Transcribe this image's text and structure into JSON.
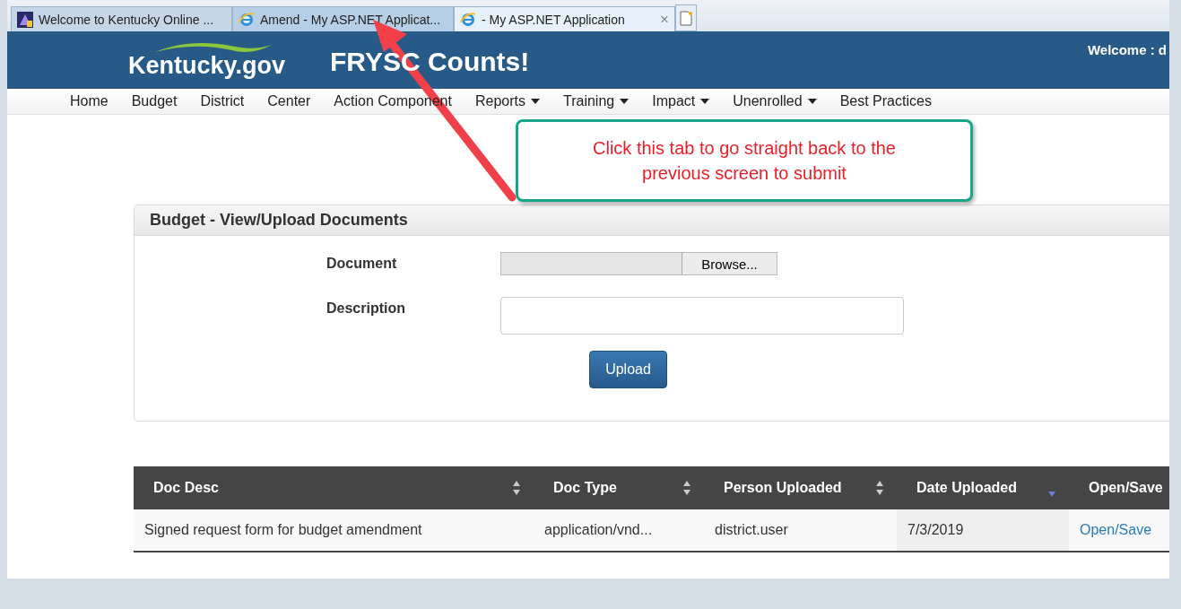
{
  "browser_tabs": [
    {
      "title": "Welcome to Kentucky Online ...",
      "kind": "app",
      "selected": false,
      "hovered": false,
      "closable": false
    },
    {
      "title": "Amend - My ASP.NET Applicat...",
      "kind": "browser",
      "selected": false,
      "hovered": true,
      "closable": false
    },
    {
      "title": "- My ASP.NET Application",
      "kind": "browser",
      "selected": true,
      "hovered": false,
      "closable": true,
      "close": "×"
    }
  ],
  "header": {
    "logo": "Kentucky.gov",
    "title": "FRYSC Counts!",
    "welcome": "Welcome : d"
  },
  "nav": [
    {
      "label": "Home",
      "dropdown": false
    },
    {
      "label": "Budget",
      "dropdown": false
    },
    {
      "label": "District",
      "dropdown": false
    },
    {
      "label": "Center",
      "dropdown": false
    },
    {
      "label": "Action Component",
      "dropdown": false
    },
    {
      "label": "Reports",
      "dropdown": true
    },
    {
      "label": "Training",
      "dropdown": true
    },
    {
      "label": "Impact",
      "dropdown": true
    },
    {
      "label": "Unenrolled",
      "dropdown": true
    },
    {
      "label": "Best Practices",
      "dropdown": false
    }
  ],
  "callout": {
    "text": "Click this tab to go straight back to the previous screen to submit"
  },
  "panel": {
    "title": "Budget - View/Upload Documents",
    "fields": [
      {
        "label": "Document",
        "kind": "file",
        "button": "Browse..."
      },
      {
        "label": "Description",
        "kind": "text"
      }
    ],
    "submit": "Upload"
  },
  "table": {
    "columns": [
      {
        "label": "Doc Desc",
        "kind": "sortable"
      },
      {
        "label": "Doc Type",
        "kind": "sortable"
      },
      {
        "label": "Person Uploaded",
        "kind": "sortable"
      },
      {
        "label": "Date Uploaded",
        "kind": "sorted"
      },
      {
        "label": "Open/Save",
        "kind": "plain"
      }
    ],
    "rows": [
      {
        "cells": [
          "Signed request form for budget amendment",
          "application/vnd...",
          "district.user",
          "7/3/2019"
        ],
        "link": "Open/Save"
      }
    ]
  }
}
